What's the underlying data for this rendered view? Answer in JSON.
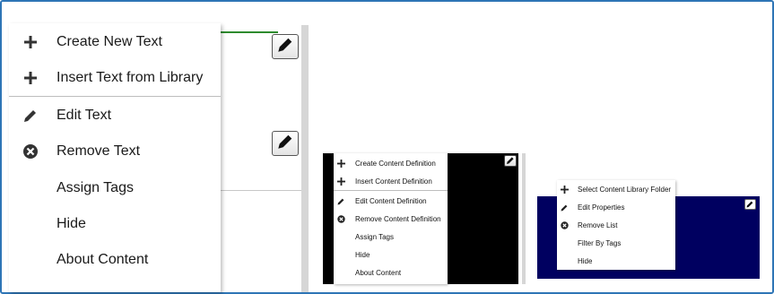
{
  "panel1": {
    "menu": {
      "items": [
        {
          "label": "Create New Text",
          "icon": "plus-icon"
        },
        {
          "label": "Insert Text from Library",
          "icon": "plus-icon"
        },
        {
          "label": "Edit Text",
          "icon": "pencil-icon"
        },
        {
          "label": "Remove Text",
          "icon": "remove-circle-icon"
        },
        {
          "label": "Assign Tags",
          "icon": ""
        },
        {
          "label": "Hide",
          "icon": ""
        },
        {
          "label": "About Content",
          "icon": ""
        }
      ]
    }
  },
  "panel2": {
    "menu": {
      "items": [
        {
          "label": "Create Content Definition",
          "icon": "plus-icon"
        },
        {
          "label": "Insert Content Definition",
          "icon": "plus-icon"
        },
        {
          "label": "Edit Content Definition",
          "icon": "pencil-icon"
        },
        {
          "label": "Remove Content Definition",
          "icon": "remove-circle-icon"
        },
        {
          "label": "Assign Tags",
          "icon": ""
        },
        {
          "label": "Hide",
          "icon": ""
        },
        {
          "label": "About Content",
          "icon": ""
        }
      ]
    },
    "background_color": "#000000"
  },
  "panel3": {
    "menu": {
      "items": [
        {
          "label": "Select Content Library Folder",
          "icon": "plus-icon"
        },
        {
          "label": "Edit Properties",
          "icon": "pencil-icon"
        },
        {
          "label": "Remove List",
          "icon": "remove-circle-icon"
        },
        {
          "label": "Filter By Tags",
          "icon": ""
        },
        {
          "label": "Hide",
          "icon": ""
        }
      ]
    },
    "background_color": "#000060"
  },
  "colors": {
    "frame_border": "#2e75b6",
    "accent_line": "#2e8b2e",
    "icon": "#333333"
  }
}
